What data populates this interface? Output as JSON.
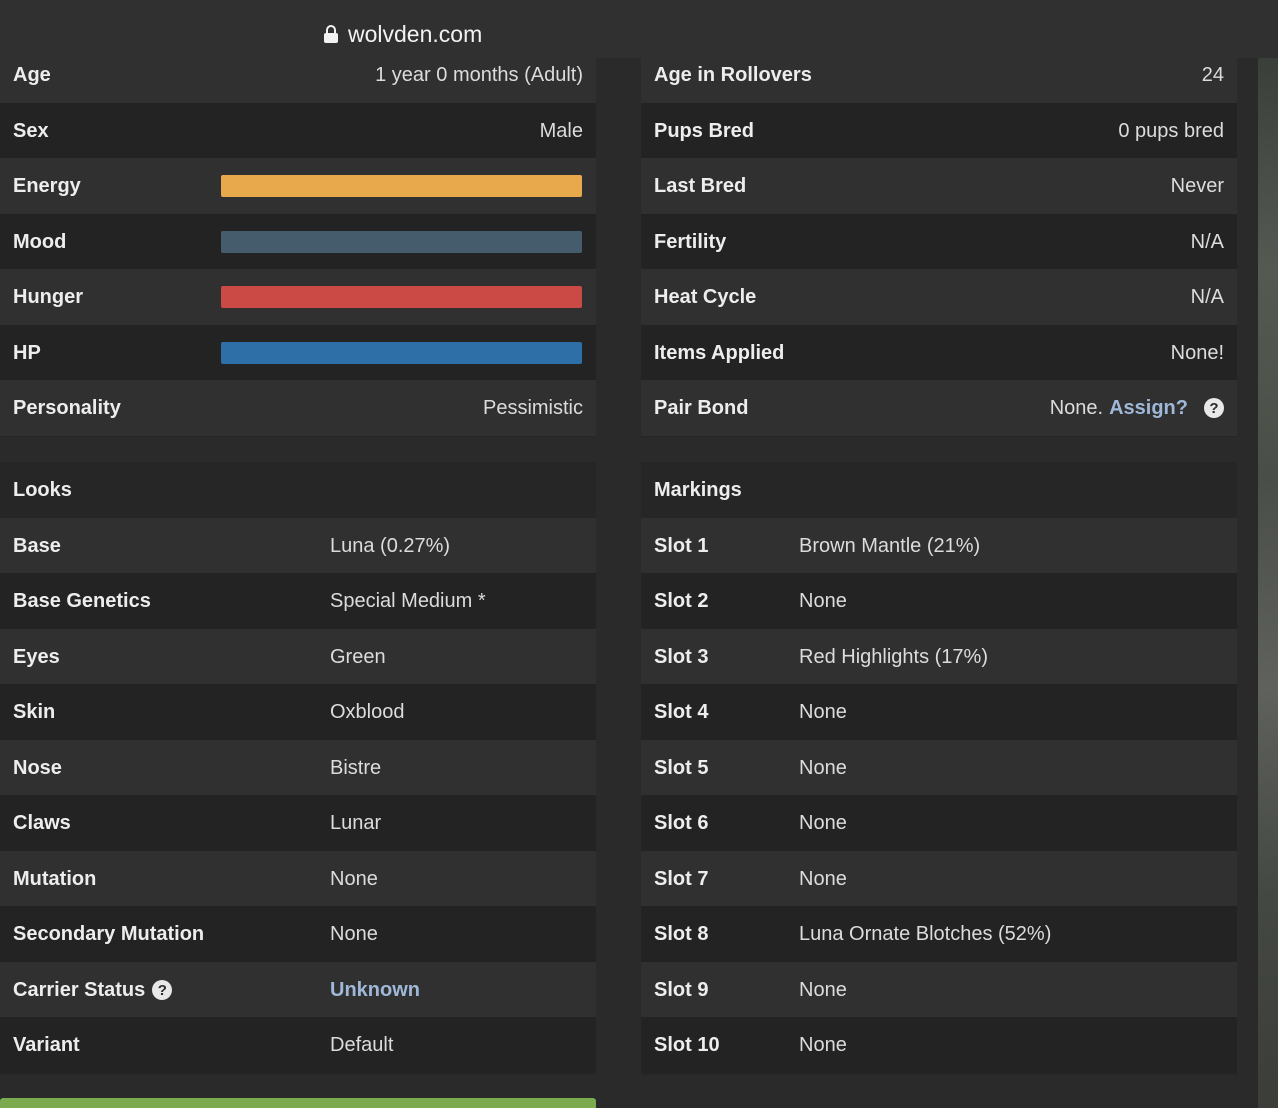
{
  "browser": {
    "url": "wolvden.com"
  },
  "stats_left": [
    {
      "label": "Age",
      "value": "1 year 0 months (Adult)"
    },
    {
      "label": "Sex",
      "value": "Male"
    },
    {
      "label": "Energy",
      "bar_color": "#e8a84c",
      "bar_fill": 1.0
    },
    {
      "label": "Mood",
      "bar_color": "#455c6c",
      "bar_fill": 1.0
    },
    {
      "label": "Hunger",
      "bar_color": "#cc4a45",
      "bar_fill": 1.0
    },
    {
      "label": "HP",
      "bar_color": "#2f6fa8",
      "bar_fill": 1.0
    },
    {
      "label": "Personality",
      "value": "Pessimistic"
    }
  ],
  "stats_right": [
    {
      "label": "Age in Rollovers",
      "value": "24"
    },
    {
      "label": "Pups Bred",
      "value": "0 pups bred"
    },
    {
      "label": "Last Bred",
      "value": "Never"
    },
    {
      "label": "Fertility",
      "value": "N/A"
    },
    {
      "label": "Heat Cycle",
      "value": "N/A"
    },
    {
      "label": "Items Applied",
      "value": "None!"
    },
    {
      "label": "Pair Bond",
      "value": "None.",
      "link": "Assign?"
    }
  ],
  "looks": {
    "title": "Looks",
    "rows": [
      {
        "label": "Base",
        "value": "Luna (0.27%)"
      },
      {
        "label": "Base Genetics",
        "value": "Special Medium *"
      },
      {
        "label": "Eyes",
        "value": "Green"
      },
      {
        "label": "Skin",
        "value": "Oxblood"
      },
      {
        "label": "Nose",
        "value": "Bistre"
      },
      {
        "label": "Claws",
        "value": "Lunar"
      },
      {
        "label": "Mutation",
        "value": "None"
      },
      {
        "label": "Secondary Mutation",
        "value": "None"
      },
      {
        "label": "Carrier Status",
        "value": "Unknown"
      },
      {
        "label": "Variant",
        "value": "Default"
      }
    ]
  },
  "markings": {
    "title": "Markings",
    "rows": [
      {
        "label": "Slot 1",
        "value": "Brown Mantle (21%)"
      },
      {
        "label": "Slot 2",
        "value": "None"
      },
      {
        "label": "Slot 3",
        "value": "Red Highlights (17%)"
      },
      {
        "label": "Slot 4",
        "value": "None"
      },
      {
        "label": "Slot 5",
        "value": "None"
      },
      {
        "label": "Slot 6",
        "value": "None"
      },
      {
        "label": "Slot 7",
        "value": "None"
      },
      {
        "label": "Slot 8",
        "value": "Luna Ornate Blotches (52%)"
      },
      {
        "label": "Slot 9",
        "value": "None"
      },
      {
        "label": "Slot 10",
        "value": "None"
      }
    ]
  },
  "colors": {
    "link": "#9fb8d8",
    "accent_green": "#7caa4e"
  }
}
